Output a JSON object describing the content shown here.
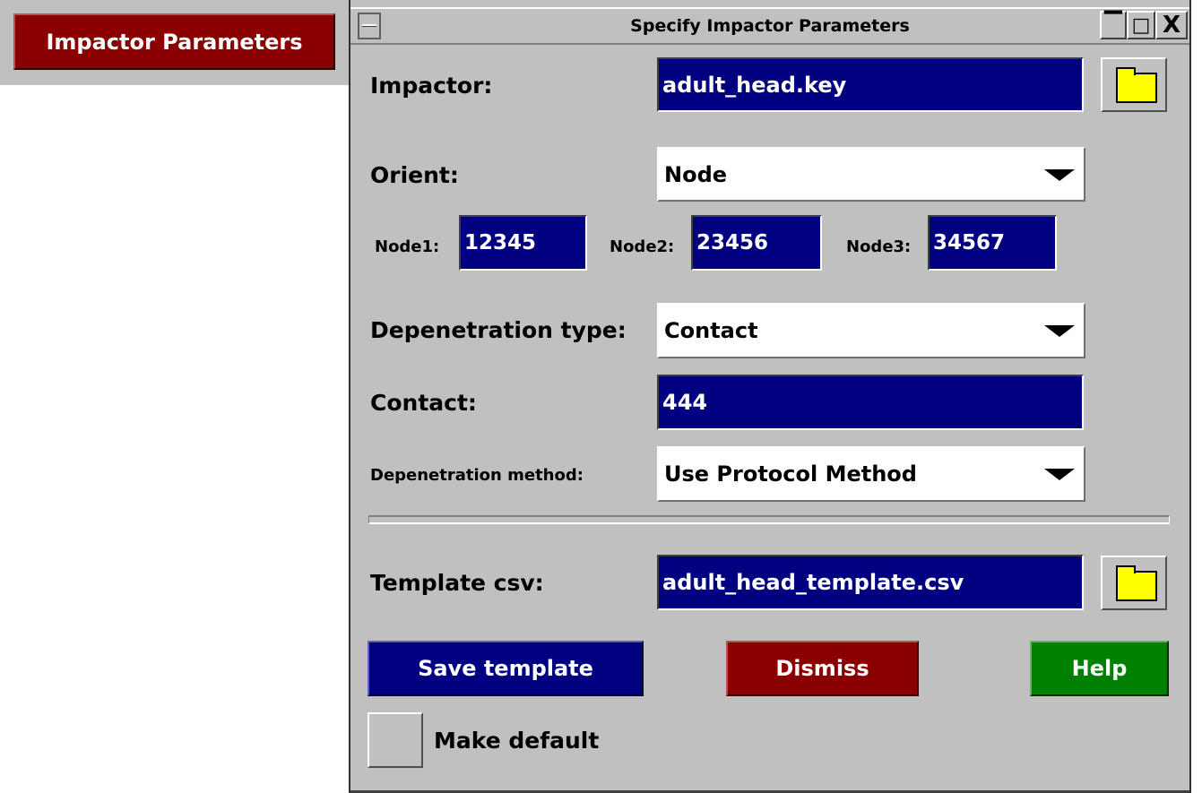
{
  "launcher": {
    "label": "Impactor Parameters"
  },
  "window": {
    "title": "Specify Impactor Parameters",
    "minimize_glyph": "▔",
    "maximize_glyph": "□",
    "close_glyph": "X"
  },
  "form": {
    "impactor": {
      "label": "Impactor:",
      "value": "adult_head.key"
    },
    "orient": {
      "label": "Orient:",
      "selected": "Node"
    },
    "nodes": [
      {
        "label": "Node1:",
        "value": "12345"
      },
      {
        "label": "Node2:",
        "value": "23456"
      },
      {
        "label": "Node3:",
        "value": "34567"
      }
    ],
    "depenetration_type": {
      "label": "Depenetration type:",
      "selected": "Contact"
    },
    "contact": {
      "label": "Contact:",
      "value": "444"
    },
    "depenetration_method": {
      "label": "Depenetration method:",
      "selected": "Use Protocol Method"
    },
    "template_csv": {
      "label": "Template csv:",
      "value": "adult_head_template.csv"
    }
  },
  "buttons": {
    "save_template": "Save template",
    "dismiss": "Dismiss",
    "help": "Help"
  },
  "make_default": {
    "label": "Make default",
    "checked": false
  },
  "icons": [
    "folder-icon",
    "dropdown-arrow-icon",
    "minimize-icon",
    "maximize-icon",
    "close-icon",
    "system-menu-icon"
  ],
  "colors": {
    "field_bg": "#000080",
    "panel_bg": "#c0c0c0",
    "launcher_bg": "#8a0000",
    "save_bg": "#000080",
    "dismiss_bg": "#8a0000",
    "help_bg": "#008000",
    "folder": "#ffff00"
  }
}
